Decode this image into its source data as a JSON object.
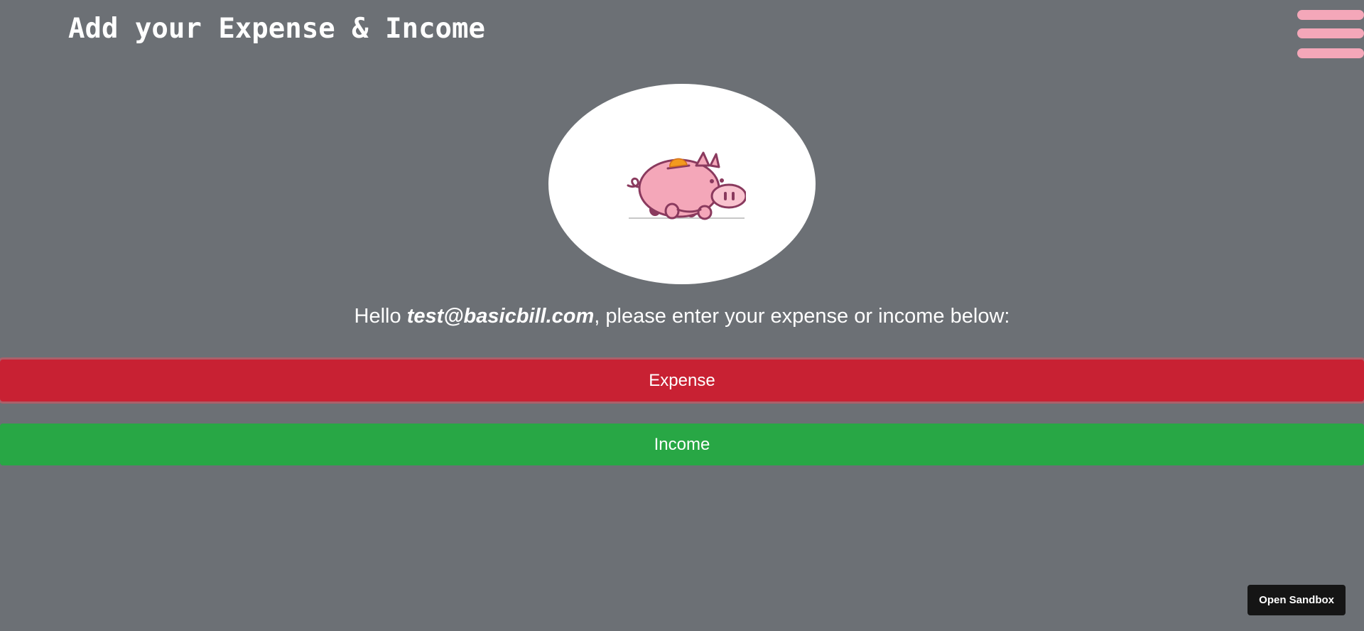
{
  "header": {
    "title": "Add your Expense & Income",
    "menu_icon": "hamburger-icon",
    "menu_color": "#f4a7b9"
  },
  "logo": {
    "icon": "piggy-bank-icon"
  },
  "greeting": {
    "prefix": "Hello ",
    "email": "test@basicbill.com",
    "suffix": ", please enter your expense or income below:"
  },
  "actions": {
    "expense_label": "Expense",
    "income_label": "Income",
    "expense_color": "#c82133",
    "income_color": "#28a745"
  },
  "sandbox": {
    "label": "Open Sandbox"
  }
}
